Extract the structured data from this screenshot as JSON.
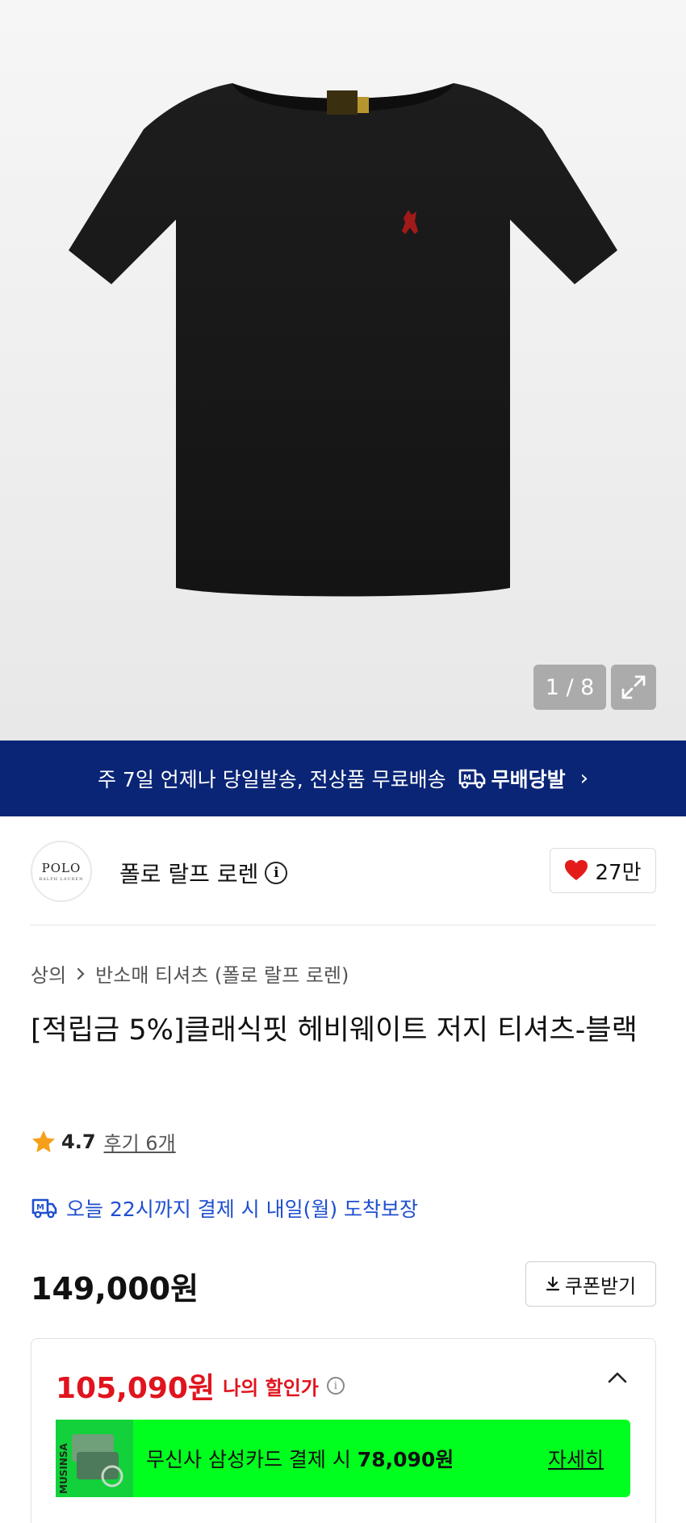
{
  "gallery": {
    "counter": "1 / 8",
    "image": "black-polo-tshirt",
    "expand_icon": "expand-icon"
  },
  "banner": {
    "text": "주 7일 언제나 당일발송, 전상품 무료배송",
    "brand": "무배당발",
    "truck_icon": "truck-icon",
    "chevron_icon": "chevron-right-icon"
  },
  "brand": {
    "logo_line1": "POLO",
    "logo_line2": "RALPH LAUREN",
    "name": "폴로 랄프 로렌",
    "info_icon": "i",
    "likes": "27만"
  },
  "product": {
    "breadcrumb": [
      "상의",
      "반소매 티셔츠 (폴로 랄프 로렌)"
    ],
    "title": "[적립금 5%]클래식핏 헤비웨이트 저지 티셔츠-블랙",
    "rating": "4.7",
    "reviews": "후기 6개",
    "delivery": "오늘 22시까지 결제 시 내일(월) 도착보장",
    "price": "149,000원",
    "coupon_label": "쿠폰받기"
  },
  "discount": {
    "price": "105,090원",
    "label": "나의 할인가",
    "info": "i",
    "card_text": "무신사 삼성카드 결제 시",
    "card_price": "78,090원",
    "card_link": "자세히",
    "card_thumb_text": "MUSINSA"
  },
  "colors": {
    "banner_bg": "#0a2576",
    "sale_red": "#e0141e",
    "card_green": "#00ff1f",
    "delivery_blue": "#1f4fd0"
  }
}
